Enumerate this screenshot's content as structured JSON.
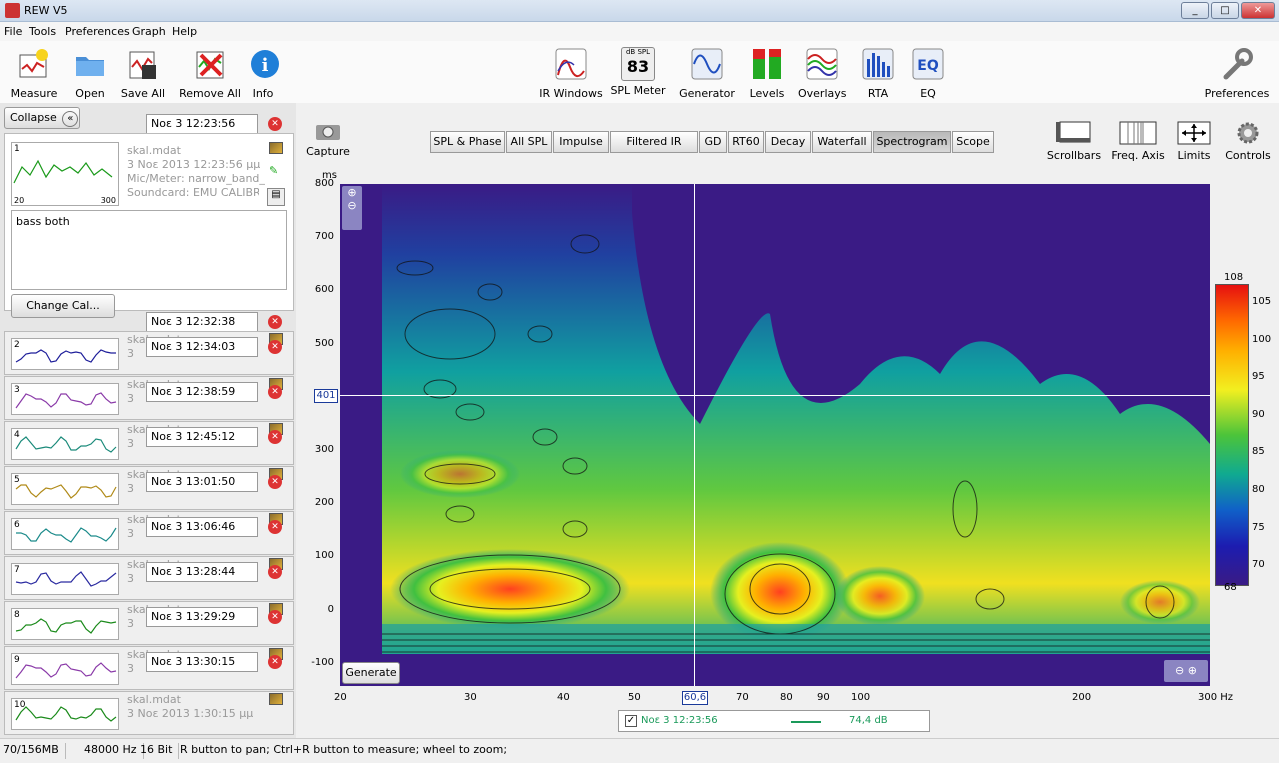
{
  "window": {
    "title": "REW V5",
    "buttons": [
      "_",
      "□",
      "✕"
    ]
  },
  "menu": [
    "File",
    "Tools",
    "Preferences",
    "Graph",
    "Help"
  ],
  "toolbar_left": [
    {
      "label": "Measure",
      "icon": "measure-icon"
    },
    {
      "label": "Open",
      "icon": "folder-icon"
    },
    {
      "label": "Save All",
      "icon": "save-icon"
    },
    {
      "label": "Remove All",
      "icon": "remove-icon"
    },
    {
      "label": "Info",
      "icon": "info-icon"
    }
  ],
  "toolbar_center": [
    {
      "label": "IR Windows",
      "icon": "ir-windows-icon"
    },
    {
      "label": "SPL Meter",
      "icon": "spl-meter-icon",
      "top": "dB SPL",
      "value": "83"
    },
    {
      "label": "Generator",
      "icon": "generator-icon"
    },
    {
      "label": "Levels",
      "icon": "levels-icon"
    },
    {
      "label": "Overlays",
      "icon": "overlays-icon"
    },
    {
      "label": "RTA",
      "icon": "rta-icon"
    },
    {
      "label": "EQ",
      "icon": "eq-icon"
    }
  ],
  "toolbar_right": {
    "label": "Preferences",
    "icon": "wrench-icon"
  },
  "left": {
    "collapse": "Collapse",
    "selected": {
      "num": "1",
      "datetime": "Νοε 3 12:23:56",
      "line1": "skal.mdat",
      "line2": "3 Νοε 2013 12:23:56 μμ",
      "line3": "Mic/Meter: narrow_band_",
      "line4": "Soundcard: EMU CALIBRA",
      "axis_lo": "20",
      "axis_hi": "300",
      "notes": "bass both",
      "change_cal": "Change Cal..."
    },
    "list": [
      {
        "num": "",
        "datetime": "Νοε 3 12:32:38",
        "name": ""
      },
      {
        "num": "2",
        "datetime": "Νοε 3 12:34:03",
        "name": "skal.mdat",
        "sub": "3"
      },
      {
        "num": "3",
        "datetime": "Νοε 3 12:38:59",
        "name": "skal.mdat",
        "sub": "3"
      },
      {
        "num": "4",
        "datetime": "Νοε 3 12:45:12",
        "name": "skal.mdat",
        "sub": "3"
      },
      {
        "num": "5",
        "datetime": "Νοε 3 13:01:50",
        "name": "skal.mdat",
        "sub": "3"
      },
      {
        "num": "6",
        "datetime": "Νοε 3 13:06:46",
        "name": "skal.mdat",
        "sub": "3"
      },
      {
        "num": "7",
        "datetime": "Νοε 3 13:28:44",
        "name": "skal.mdat",
        "sub": "3"
      },
      {
        "num": "8",
        "datetime": "Νοε 3 13:29:29",
        "name": "skal.mdat",
        "sub": "3"
      },
      {
        "num": "9",
        "datetime": "Νοε 3 13:30:15",
        "name": "skal.mdat",
        "sub": "3"
      },
      {
        "num": "10",
        "datetime": "",
        "name": "skal.mdat",
        "sub": "3 Νοε 2013 1:30:15 μμ"
      }
    ],
    "thumb_colors": [
      "#1a9a1a",
      "#1e1e9a",
      "#8a3aa8",
      "#1a8a7a",
      "#b08a18",
      "#1a8a8a",
      "#2a2aa0",
      "#1a8a1a",
      "#8a3aa8",
      "#1a8a1a"
    ]
  },
  "graph": {
    "capture": "Capture",
    "tabs": [
      "SPL & Phase",
      "All SPL",
      "Impulse",
      "Filtered IR",
      "GD",
      "RT60",
      "Decay",
      "Waterfall",
      "Spectrogram",
      "Scope"
    ],
    "selected_tab": "Spectrogram",
    "right_tools": [
      {
        "label": "Scrollbars",
        "icon": "scrollbars-icon"
      },
      {
        "label": "Freq. Axis",
        "icon": "freq-axis-icon"
      },
      {
        "label": "Limits",
        "icon": "limits-icon"
      },
      {
        "label": "Controls",
        "icon": "gear-icon"
      }
    ],
    "y_unit": "ms",
    "y_ticks": [
      "800",
      "700",
      "600",
      "500",
      "400",
      "300",
      "200",
      "100",
      "0",
      "-100"
    ],
    "x_ticks": [
      "20",
      "30",
      "40",
      "50",
      "70",
      "80",
      "90",
      "100",
      "200",
      "300 Hz"
    ],
    "cursor_x": "60,6",
    "cursor_y": "401",
    "generate": "Generate",
    "colorbar_ticks": [
      "108",
      "105",
      "100",
      "95",
      "90",
      "85",
      "80",
      "75",
      "70",
      "68"
    ],
    "legend": {
      "name": "Νοε 3 12:23:56",
      "value": "74,4 dB"
    }
  },
  "status": [
    "70/156MB",
    "48000 Hz",
    "16 Bit",
    "R button to pan; Ctrl+R button to measure; wheel to zoom;"
  ]
}
